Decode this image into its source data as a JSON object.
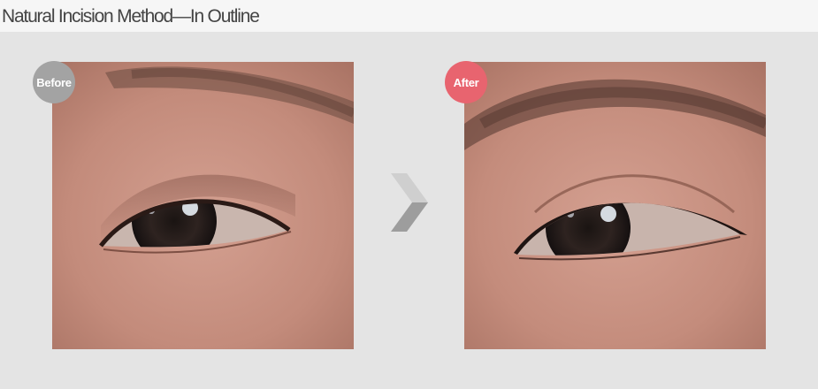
{
  "title": "Natural Incision Method—In Outline",
  "before": {
    "badge": "Before",
    "image": "close-up photo of a single eyelid before surgery"
  },
  "after": {
    "badge": "After",
    "image": "close-up photo of the same eye with a double eyelid crease after surgery"
  },
  "arrow_icon": "chevron-right-icon",
  "colors": {
    "background": "#e4e4e4",
    "header": "#f6f6f6",
    "before_badge": "#a3a3a3",
    "after_badge": "#e8646f",
    "skin": "#c89284"
  }
}
